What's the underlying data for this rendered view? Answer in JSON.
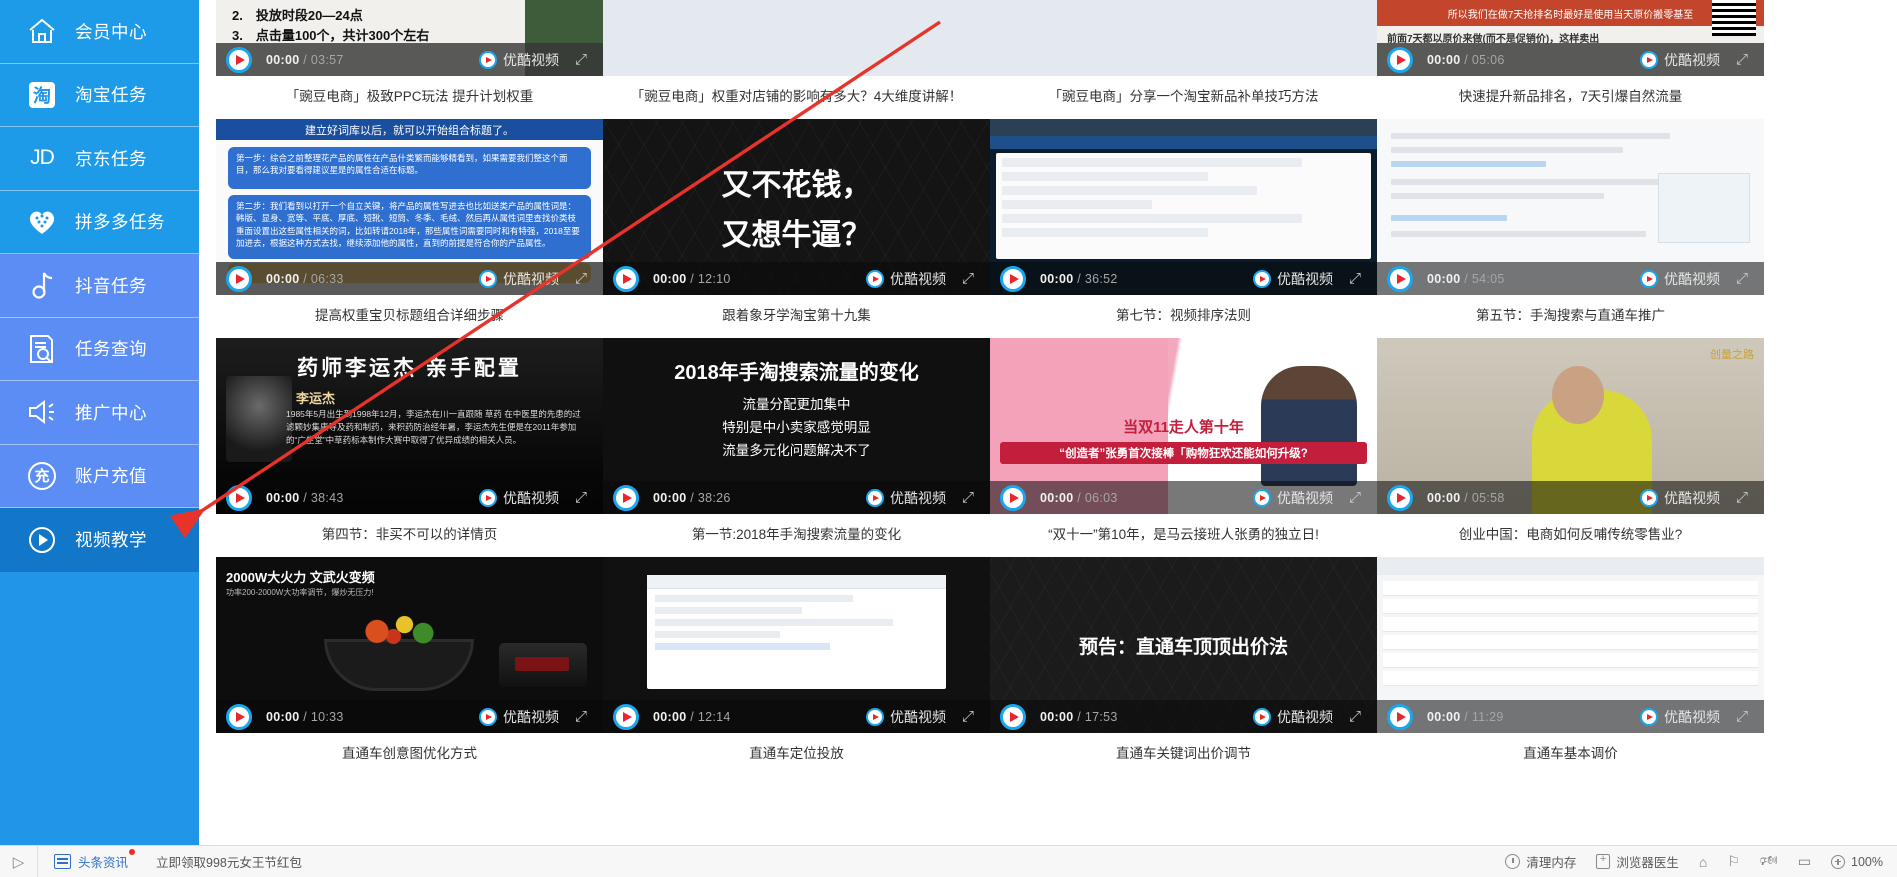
{
  "sidebar": {
    "items": [
      {
        "label": "会员中心",
        "icon": "home-icon",
        "style": "light",
        "active": false
      },
      {
        "label": "淘宝任务",
        "icon": "taobao-icon",
        "style": "light",
        "active": false
      },
      {
        "label": "京东任务",
        "icon": "jd-icon",
        "style": "light",
        "active": false
      },
      {
        "label": "拼多多任务",
        "icon": "pinduoduo-icon",
        "style": "light",
        "active": false
      },
      {
        "label": "抖音任务",
        "icon": "douyin-icon",
        "style": "alt",
        "active": false
      },
      {
        "label": "任务查询",
        "icon": "task-query-icon",
        "style": "alt",
        "active": false
      },
      {
        "label": "推广中心",
        "icon": "megaphone-icon",
        "style": "alt",
        "active": false
      },
      {
        "label": "账户充值",
        "icon": "recharge-icon",
        "style": "alt",
        "active": false
      },
      {
        "label": "视频教学",
        "icon": "play-circle-icon",
        "style": "active",
        "active": true
      }
    ]
  },
  "videos": [
    {
      "caption": "「豌豆电商」极致PPC玩法 提升计划权重",
      "current_time": "00:00",
      "duration": "03:57",
      "brand": "优酷视频",
      "art": "slide-white",
      "slide_lines": [
        "2.　投放时段20—24点",
        "3.　点击量100个，共计300个左右"
      ]
    },
    {
      "caption": "「豌豆电商」权重对店铺的影响有多大？4大维度讲解！",
      "current_time": "",
      "duration": "",
      "brand": "",
      "art": "blank"
    },
    {
      "caption": "「豌豆电商」分享一个淘宝新品补单技巧方法",
      "current_time": "",
      "duration": "",
      "brand": "",
      "art": "blank"
    },
    {
      "caption": "快速提升新品排名，7天引爆自然流量",
      "current_time": "00:00",
      "duration": "05:06",
      "brand": "优酷视频",
      "art": "orange-notice",
      "notice_top": "所以我们在做7天抢排名时最好是使用当天原价搬零基至",
      "notice_sub": "前面7天都以原价来做(而不是促销价)，这样卖出"
    },
    {
      "caption": "提高权重宝贝标题组合详细步骤",
      "current_time": "00:00",
      "duration": "06:33",
      "brand": "优酷视频",
      "art": "ppt-blue",
      "ppt_head": "建立好词库以后，就可以开始组合标题了。",
      "ppt_b1": "第一步：综合之前整理花产品的属性在产品什类繁而能够精看到，如果需要我们整这个面目，那么我对要看得建议星是的属性合适在标题。",
      "ppt_b2": "第二步：我们看到以打开一个自立关键，将产品的属性写进去也比如送类产品的属性词是：韩版、显身、宽等、平底、厚底、短靴、短筒、冬季、毛绒、然后再从属性词里查找价类枝重面设置出这些属性相关的词，比如转请2018年，那些属性词需要同时和有特强，2018至要加进去，根据这种方式去找，继续添加他的属性，直到的前提是符合你的产品属性。"
    },
    {
      "caption": "跟着象牙学淘宝第十九集",
      "current_time": "00:00",
      "duration": "12:10",
      "brand": "优酷视频",
      "art": "hex-title",
      "hex_line1": "又不花钱，",
      "hex_line2": "又想牛逼？"
    },
    {
      "caption": "第七节：视频排序法则",
      "current_time": "00:00",
      "duration": "36:52",
      "brand": "优酷视频",
      "art": "browser"
    },
    {
      "caption": "第五节：手淘搜索与直通车推广",
      "current_time": "00:00",
      "duration": "54:05",
      "brand": "优酷视频",
      "art": "doc"
    },
    {
      "caption": "第四节：非买不可以的详情页",
      "current_time": "00:00",
      "duration": "38:43",
      "brand": "优酷视频",
      "art": "portrait",
      "portrait_title": "药师李运杰  亲手配置",
      "portrait_name": "李运杰",
      "portrait_body": "1985年5月出生到1998年12月，李运杰在川一直跟随 草药 在中医里的先患的过滤颗妙集康导及药和制药，来积药防治经年暑，李运杰先生便是在2011年参加的“广生堂”中草药标本制作大赛中取得了优异成绩的相关人员。"
    },
    {
      "caption": "第一节:2018年手淘搜索流量的变化",
      "current_time": "00:00",
      "duration": "38:26",
      "brand": "优酷视频",
      "art": "t2018",
      "t2018_title": "2018年手淘搜索流量的变化",
      "t2018_l1": "流量分配更加集中",
      "t2018_l2": "特别是中小卖家感觉明显",
      "t2018_l3": "流量多元化问题解决不了"
    },
    {
      "caption": "“双十一”第10年，是马云接班人张勇的独立日!",
      "current_time": "00:00",
      "duration": "06:03",
      "brand": "优酷视频",
      "art": "pink",
      "pink_main": "当双11走人第十年",
      "pink_sub": "“创造者”张勇首次接棒「购物狂欢还能如何升级?"
    },
    {
      "caption": "创业中国：电商如何反哺传统零售业?",
      "current_time": "00:00",
      "duration": "05:58",
      "brand": "优酷视频",
      "art": "yellow-man",
      "ym_badge": "创量之路"
    },
    {
      "caption": "直通车创意图优化方式",
      "current_time": "00:00",
      "duration": "10:33",
      "brand": "优酷视频",
      "art": "wok",
      "wok_title": "2000W大火力  文武火变频",
      "wok_sub": "功率200-2000W大功率调节，爆炒无压力!"
    },
    {
      "caption": "直通车定位投放",
      "current_time": "00:00",
      "duration": "12:14",
      "brand": "优酷视频",
      "art": "table-ui"
    },
    {
      "caption": "直通车关键词出价调节",
      "current_time": "00:00",
      "duration": "17:53",
      "brand": "优酷视频",
      "art": "gray-hex-title",
      "gray_title": "预告：直通车顶顶出价法"
    },
    {
      "caption": "直通车基本调价",
      "current_time": "00:00",
      "duration": "11:29",
      "brand": "优酷视频",
      "art": "table-ui"
    }
  ],
  "taskbar": {
    "chevron": "▷",
    "news_label": "头条资讯",
    "promo": "立即领取998元女王节红包",
    "clean_memory": "清理内存",
    "browser_doctor": "浏览器医生",
    "zoom_level": "100%",
    "icons": [
      "broom-icon",
      "flag-icon",
      "speaker-icon",
      "window-icon",
      "zoom-icon"
    ]
  },
  "colors": {
    "sidebar_blue": "#2196e8",
    "sidebar_alt": "#5b8df5",
    "sidebar_active": "#1276c9",
    "arrow_red": "#e8332a"
  }
}
